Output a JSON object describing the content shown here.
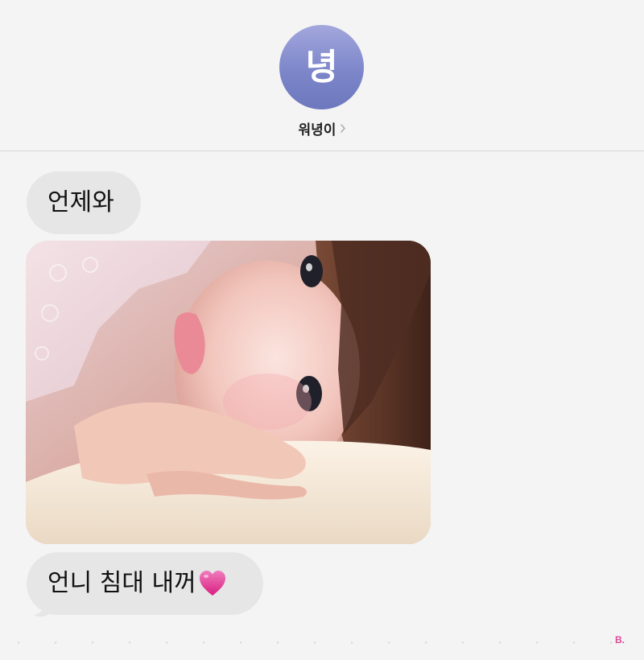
{
  "header": {
    "avatar_initial": "녕",
    "contact_name": "워녕이"
  },
  "messages": [
    {
      "text": "언제와"
    },
    {
      "image": "photo-of-person-lying-on-pillow"
    },
    {
      "text": "언니 침대 내꺼",
      "emoji": "heart-icon"
    }
  ],
  "watermark": "B.",
  "colors": {
    "background": "#f4f4f4",
    "bubble": "#e6e6e6",
    "avatar_top": "#a3a7dd",
    "avatar_bottom": "#6d78bd",
    "heart": "#e5338f",
    "watermark": "#e0489b"
  }
}
